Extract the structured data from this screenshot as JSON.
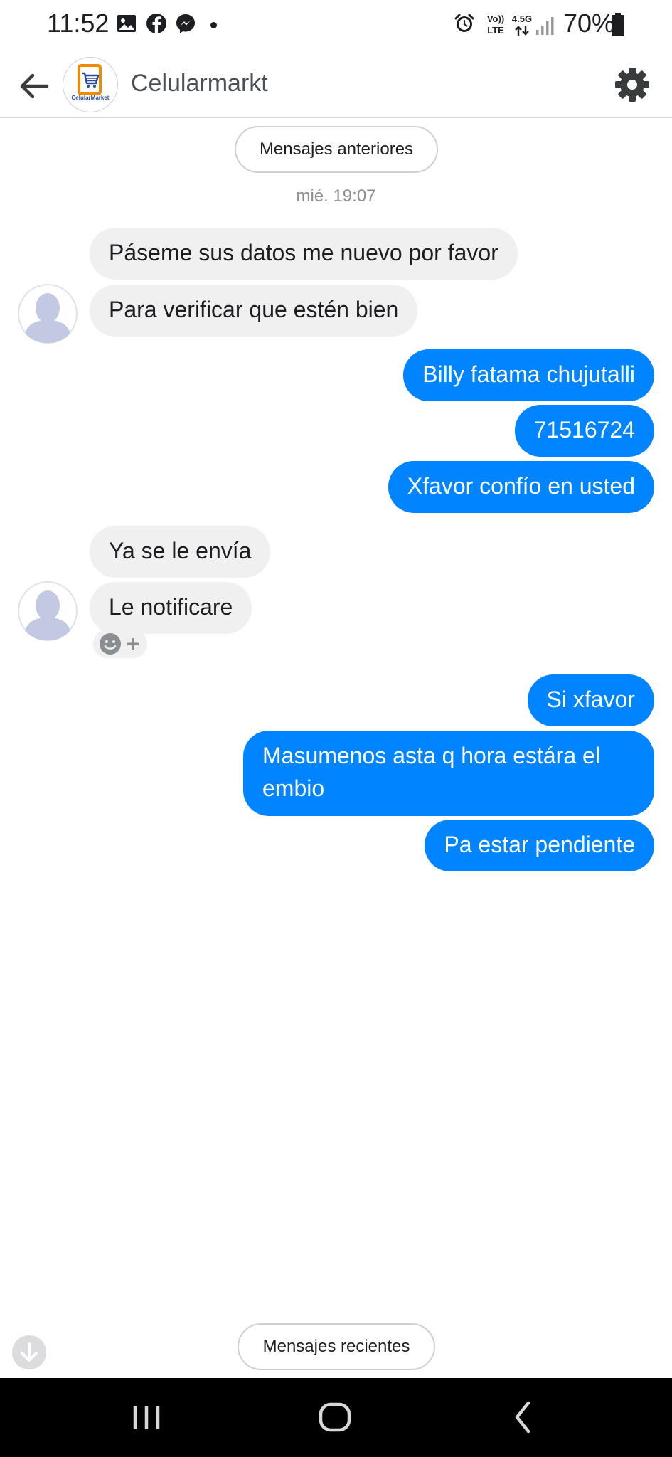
{
  "status_bar": {
    "time": "11:52",
    "volte_top": "Vo))",
    "volte_bottom": "LTE",
    "network_top": "4.5G",
    "battery": "70%"
  },
  "header": {
    "title": "Celularmarkt",
    "logo_text": "CelularMarket",
    "icons": [
      "back-arrow-icon",
      "gear-icon"
    ]
  },
  "conversation": {
    "older_messages_label": "Mensajes anteriores",
    "timestamp": "mié. 19:07",
    "recent_messages_label": "Mensajes recientes",
    "messages": [
      {
        "sender": "contact",
        "text": "Páseme sus datos me nuevo por favor"
      },
      {
        "sender": "contact",
        "text": "Para verificar que estén bien"
      },
      {
        "sender": "me",
        "text": "Billy fatama chujutalli"
      },
      {
        "sender": "me",
        "text": "71516724"
      },
      {
        "sender": "me",
        "text": "Xfavor confío en usted"
      },
      {
        "sender": "contact",
        "text": "Ya se le envía"
      },
      {
        "sender": "contact",
        "text": "Le notificare"
      },
      {
        "sender": "me",
        "text": "Si xfavor"
      },
      {
        "sender": "me",
        "text": "Masumenos asta q hora estára el embio"
      },
      {
        "sender": "me",
        "text": "Pa estar pendiente"
      }
    ]
  },
  "colors": {
    "outgoing_bubble": "#0084ff",
    "incoming_bubble": "#f0f0f0",
    "avatar_placeholder": "#c3c8e3"
  }
}
